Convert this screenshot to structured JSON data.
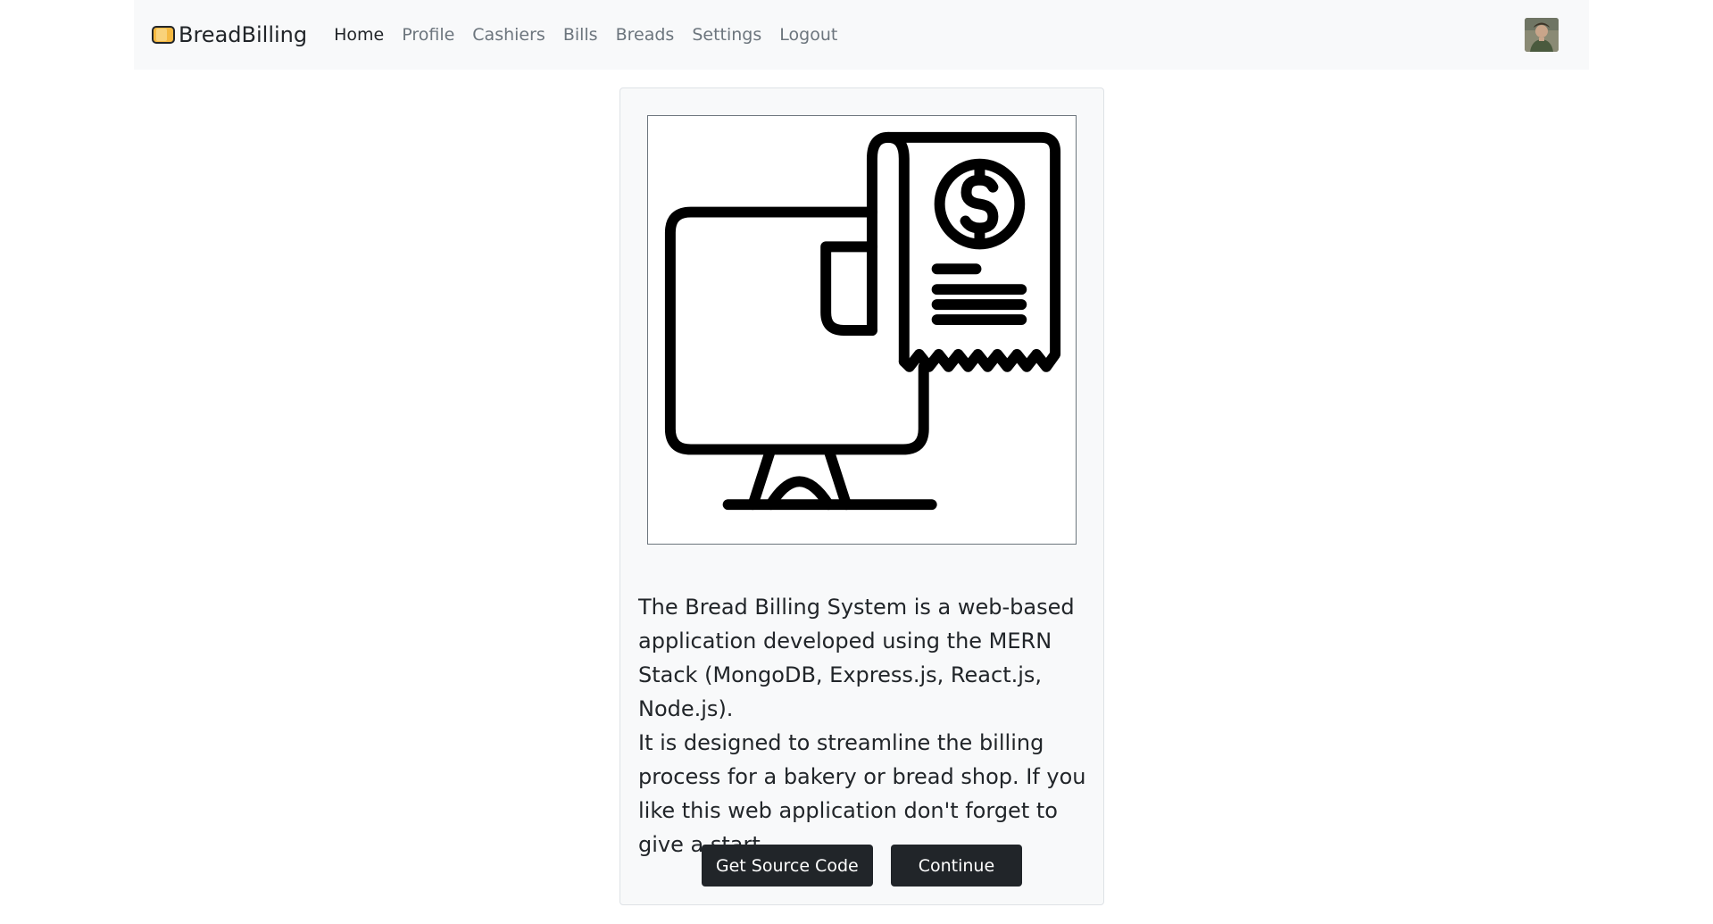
{
  "brand": {
    "name": "BreadBilling",
    "icon": "bread-icon"
  },
  "nav": {
    "items": [
      {
        "label": "Home",
        "active": true
      },
      {
        "label": "Profile",
        "active": false
      },
      {
        "label": "Cashiers",
        "active": false
      },
      {
        "label": "Bills",
        "active": false
      },
      {
        "label": "Breads",
        "active": false
      },
      {
        "label": "Settings",
        "active": false
      },
      {
        "label": "Logout",
        "active": false
      }
    ]
  },
  "avatar": {
    "icon": "user-avatar"
  },
  "hero": {
    "icon": "monitor-receipt-dollar-icon"
  },
  "description": {
    "line1": "The Bread Billing System is a web-based application developed using the MERN Stack (MongoDB, Express.js, React.js, Node.js).",
    "line2": "It is designed to streamline the billing process for a bakery or bread shop. If you like this web application don't forget to give a start."
  },
  "actions": {
    "source_label": "Get Source Code",
    "continue_label": "Continue"
  },
  "colors": {
    "navbar_bg": "#f8f9fa",
    "card_bg": "#f8f9fa",
    "button_bg": "#212529",
    "active_link": "#212529",
    "inactive_link": "#6c757d",
    "brand_accent": "#f5b942"
  }
}
